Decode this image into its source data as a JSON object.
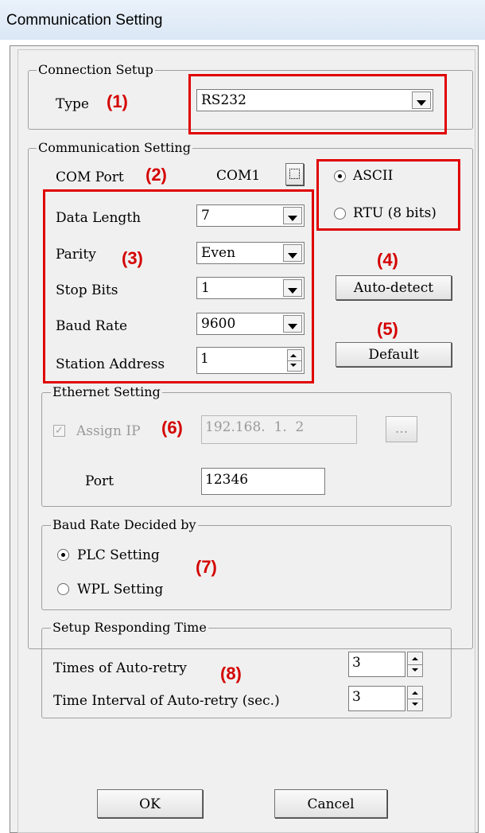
{
  "window": {
    "title": "Communication Setting"
  },
  "connection": {
    "legend": "Connection Setup",
    "type_label": "Type",
    "type_value": "RS232"
  },
  "comm": {
    "legend": "Communication Setting",
    "com_port_label": "COM Port",
    "com_port_value": "COM1",
    "fields": [
      {
        "label": "Data Length",
        "value": "7"
      },
      {
        "label": "Parity",
        "value": "Even"
      },
      {
        "label": "Stop Bits",
        "value": "1"
      },
      {
        "label": "Baud Rate",
        "value": "9600"
      },
      {
        "label": "Station Address",
        "value": "1"
      }
    ],
    "mode_ascii": "ASCII",
    "mode_rtu": "RTU (8 bits)",
    "selected_mode": "ASCII",
    "auto_detect": "Auto-detect",
    "default": "Default"
  },
  "ethernet": {
    "legend": "Ethernet Setting",
    "assign_ip_label": "Assign IP",
    "assign_ip_checked": true,
    "ip_value": "192.168.  1.  2",
    "browse_label": "...",
    "port_label": "Port",
    "port_value": "12346"
  },
  "baud_decided": {
    "legend": "Baud Rate Decided by",
    "plc": "PLC Setting",
    "wpl": "WPL Setting",
    "selected": "PLC Setting"
  },
  "responding": {
    "legend": "Setup Responding Time",
    "retry_label": "Times of Auto-retry",
    "retry_value": "3",
    "interval_label": "Time Interval of Auto-retry (sec.)",
    "interval_value": "3"
  },
  "buttons": {
    "ok": "OK",
    "cancel": "Cancel"
  },
  "annotations": [
    "(1)",
    "(2)",
    "(3)",
    "(4)",
    "(5)",
    "(6)",
    "(7)",
    "(8)"
  ],
  "colors": {
    "annotation": "#d40000",
    "dialog_bg": "#f0f0f0"
  }
}
